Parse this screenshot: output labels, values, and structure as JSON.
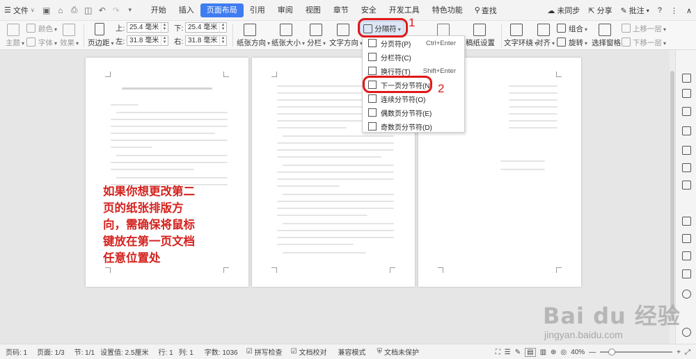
{
  "menubar": {
    "file_label": "文件",
    "tabs": [
      "开始",
      "插入",
      "页面布局",
      "引用",
      "审阅",
      "视图",
      "章节",
      "安全",
      "开发工具",
      "特色功能"
    ],
    "search_label": "查找",
    "right_items": [
      "未同步",
      "分享",
      "批注"
    ],
    "help": "?"
  },
  "ribbon": {
    "theme_label": "主题",
    "color_label": "颜色",
    "font_label": "字体",
    "effect_label": "效果",
    "margin_label": "页边距",
    "top_label": "上:",
    "bottom_label": "下:",
    "left_label": "左:",
    "right_label": "右:",
    "top_value": "25.4 毫米",
    "bottom_value": "25.4 毫米",
    "left_value": "31.8 毫米",
    "right_value": "31.8 毫米",
    "orientation_label": "纸张方向",
    "size_label": "纸张大小",
    "columns_label": "分栏",
    "text_dir_label": "文字方向",
    "breaks_label": "分隔符",
    "manuscript_label": "稿纸设置",
    "wrap_label": "文字环绕",
    "align_label": "对齐",
    "group_label": "组合",
    "rotate_label": "旋转",
    "selection_pane_label": "选择窗格",
    "bring_forward_label": "上移一层",
    "send_backward_label": "下移一层"
  },
  "dropdown": {
    "items": [
      {
        "label": "分页符(P)",
        "shortcut": "Ctrl+Enter"
      },
      {
        "label": "分栏符(C)",
        "shortcut": ""
      },
      {
        "label": "换行符(T)",
        "shortcut": "Shift+Enter"
      },
      {
        "label": "下一页分节符(N)",
        "shortcut": ""
      },
      {
        "label": "连续分节符(O)",
        "shortcut": ""
      },
      {
        "label": "偶数页分节符(E)",
        "shortcut": ""
      },
      {
        "label": "奇数页分节符(D)",
        "shortcut": ""
      }
    ]
  },
  "annotations": {
    "step1": "1",
    "step2": "2",
    "note": "如果你想更改第二\n页的纸张排版方\n向，需确保将鼠标\n键放在第一页文档\n任意位置处"
  },
  "status": {
    "page_num": "页码: 1",
    "pages": "页面: 1/3",
    "section": "节: 1/1",
    "setting": "设置值: 2.5厘米",
    "row": "行: 1",
    "col": "列: 1",
    "word_count": "字数: 1036",
    "spell_check": "拼写检查",
    "doc_check": "文档校对",
    "compat": "兼容模式",
    "protect": "文档未保护",
    "zoom": "40%",
    "zoom_level": 0.4
  },
  "watermark": {
    "main": "Bai du 经验",
    "sub": "jingyan.baidu.com"
  },
  "colors": {
    "accent": "#3f7cf0",
    "annotation_red": "#d4231f"
  }
}
